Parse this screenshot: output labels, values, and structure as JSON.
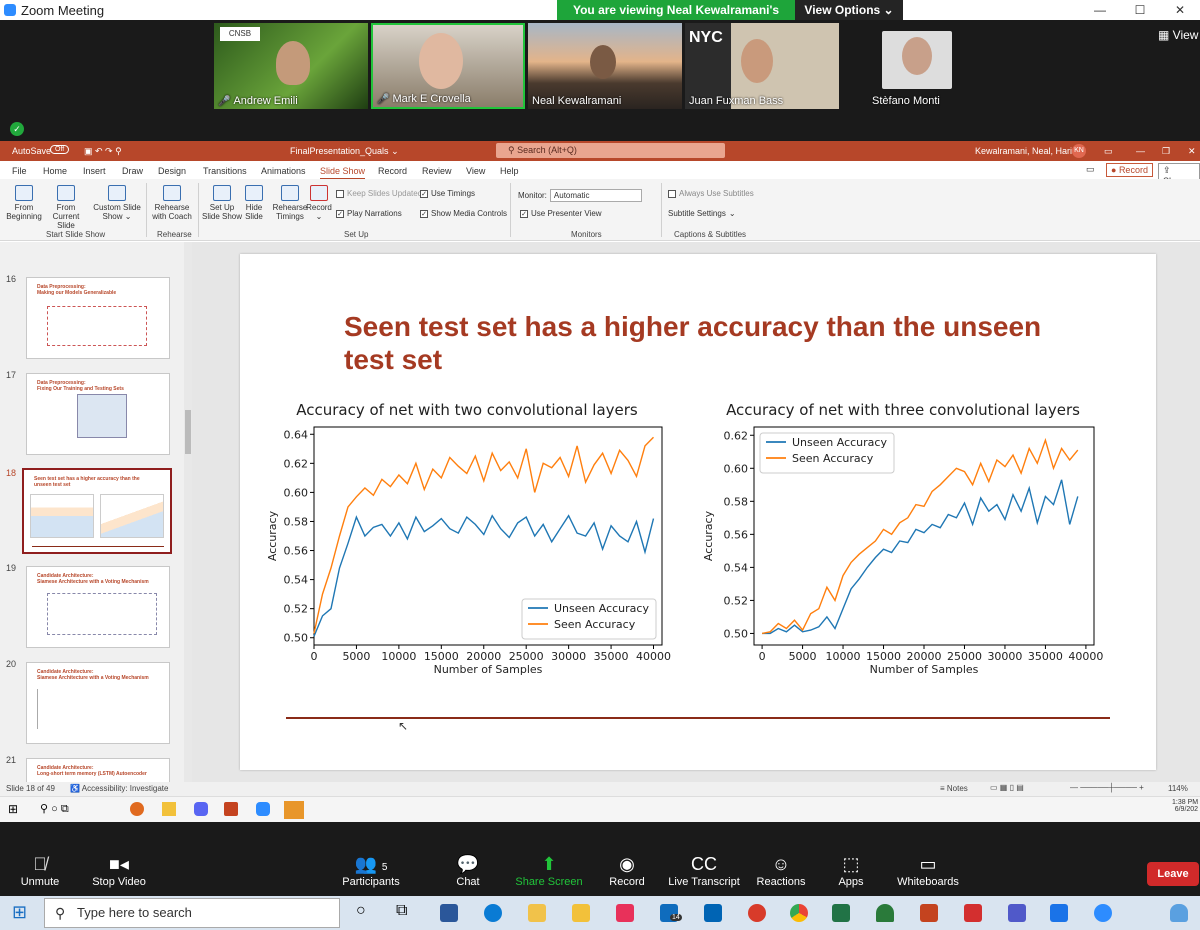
{
  "zoom": {
    "window_title": "Zoom Meeting",
    "banner_text": "You are viewing Neal Kewalramani's screen",
    "view_options": "View Options",
    "view_btn": "View",
    "participants": [
      {
        "name": "Andrew Emili",
        "muted": true,
        "color": "#3f6b2a"
      },
      {
        "name": "Mark E Crovella",
        "muted": true,
        "color": "#8a7d6a"
      },
      {
        "name": "Neal Kewalramani",
        "muted": false,
        "color": "#6a5a4a"
      },
      {
        "name": "Juan Fuxman Bass",
        "muted": false,
        "color": "#9a8a70"
      },
      {
        "name": "Stèfano Monti",
        "muted": false,
        "color": "#1a1a1a"
      }
    ],
    "controls": {
      "unmute": "Unmute",
      "stop_video": "Stop Video",
      "participants": "Participants",
      "participants_count": "5",
      "chat": "Chat",
      "share_screen": "Share Screen",
      "record": "Record",
      "live_transcript": "Live Transcript",
      "reactions": "Reactions",
      "apps": "Apps",
      "whiteboards": "Whiteboards",
      "leave": "Leave"
    }
  },
  "ppt": {
    "autosave": "AutoSave",
    "autosave_state": "Off",
    "filename": "FinalPresentation_Quals",
    "search_placeholder": "Search (Alt+Q)",
    "user": "Kewalramani, Neal, Harish",
    "user_initials": "KN",
    "menu": [
      "File",
      "Home",
      "Insert",
      "Draw",
      "Design",
      "Transitions",
      "Animations",
      "Slide Show",
      "Record",
      "Review",
      "View",
      "Help"
    ],
    "active_menu": "Slide Show",
    "record_btn": "Record",
    "share_btn": "Share",
    "ribbon": {
      "from_beginning": "From Beginning",
      "from_current": "From Current Slide",
      "custom_show": "Custom Slide Show",
      "group_start": "Start Slide Show",
      "rehearse_coach": "Rehearse with Coach",
      "group_rehearse": "Rehearse",
      "setup_show": "Set Up Slide Show",
      "hide_slide": "Hide Slide",
      "rehearse_timings": "Rehearse Timings",
      "record": "Record",
      "keep_updated": "Keep Slides Updated",
      "play_narrations": "Play Narrations",
      "use_timings": "Use Timings",
      "show_media": "Show Media Controls",
      "group_setup": "Set Up",
      "monitor_label": "Monitor:",
      "monitor_value": "Automatic",
      "presenter_view": "Use Presenter View",
      "group_monitors": "Monitors",
      "always_subtitles": "Always Use Subtitles",
      "subtitle_settings": "Subtitle Settings",
      "group_captions": "Captions & Subtitles"
    },
    "thumbnails": [
      {
        "num": "16",
        "title": "Data Preprocessing:\nMaking our Models Generalizable"
      },
      {
        "num": "17",
        "title": "Data Preprocessing:\nFixing Our Training and Testing Sets"
      },
      {
        "num": "18",
        "title": "Seen test set has a higher accuracy than the\nunseen test set"
      },
      {
        "num": "19",
        "title": "Candidate Architecture:\nSiamese Architecture with a Voting Mechanism"
      },
      {
        "num": "20",
        "title": "Candidate Architecture:\nSiamese Architecture with a Voting Mechanism"
      },
      {
        "num": "21",
        "title": "Candidate Architecture:\nLong-short term memory (LSTM) Autoencoder"
      }
    ],
    "slide_title": "Seen test set has a higher accuracy than the unseen test set",
    "status": {
      "slide_of": "Slide 18 of 49",
      "accessibility": "Accessibility: Investigate",
      "notes": "Notes",
      "zoom": "114%"
    },
    "clock_time": "1:38 PM",
    "clock_date": "6/9/202"
  },
  "chart_data": [
    {
      "type": "line",
      "title": "Accuracy of net with two convolutional layers",
      "xlabel": "Number of Samples",
      "ylabel": "Accuracy",
      "xlim": [
        0,
        41000
      ],
      "ylim": [
        0.495,
        0.645
      ],
      "xticks": [
        0,
        5000,
        10000,
        15000,
        20000,
        25000,
        30000,
        35000,
        40000
      ],
      "yticks": [
        0.5,
        0.52,
        0.54,
        0.56,
        0.58,
        0.6,
        0.62,
        0.64
      ],
      "legend": "bottom-right",
      "series": [
        {
          "name": "Unseen Accuracy",
          "color": "#1f77b4",
          "x": [
            0,
            1000,
            2000,
            3000,
            4000,
            5000,
            6000,
            7000,
            8000,
            9000,
            10000,
            11000,
            12000,
            13000,
            14000,
            15000,
            16000,
            17000,
            18000,
            19000,
            20000,
            21000,
            22000,
            23000,
            24000,
            25000,
            26000,
            27000,
            28000,
            29000,
            30000,
            31000,
            32000,
            33000,
            34000,
            35000,
            36000,
            37000,
            38000,
            39000,
            40000
          ],
          "values": [
            0.501,
            0.515,
            0.52,
            0.548,
            0.565,
            0.583,
            0.57,
            0.576,
            0.578,
            0.57,
            0.579,
            0.568,
            0.583,
            0.573,
            0.577,
            0.582,
            0.575,
            0.572,
            0.583,
            0.578,
            0.571,
            0.584,
            0.575,
            0.569,
            0.579,
            0.583,
            0.57,
            0.578,
            0.566,
            0.575,
            0.584,
            0.572,
            0.57,
            0.579,
            0.561,
            0.577,
            0.57,
            0.566,
            0.58,
            0.559,
            0.582
          ]
        },
        {
          "name": "Seen Accuracy",
          "color": "#ff7f0e",
          "x": [
            0,
            1000,
            2000,
            3000,
            4000,
            5000,
            6000,
            7000,
            8000,
            9000,
            10000,
            11000,
            12000,
            13000,
            14000,
            15000,
            16000,
            17000,
            18000,
            19000,
            20000,
            21000,
            22000,
            23000,
            24000,
            25000,
            26000,
            27000,
            28000,
            29000,
            30000,
            31000,
            32000,
            33000,
            34000,
            35000,
            36000,
            37000,
            38000,
            39000,
            40000
          ],
          "values": [
            0.503,
            0.53,
            0.548,
            0.57,
            0.59,
            0.597,
            0.603,
            0.598,
            0.609,
            0.604,
            0.612,
            0.606,
            0.62,
            0.602,
            0.616,
            0.61,
            0.624,
            0.618,
            0.613,
            0.625,
            0.608,
            0.627,
            0.615,
            0.621,
            0.61,
            0.63,
            0.6,
            0.62,
            0.617,
            0.624,
            0.611,
            0.632,
            0.607,
            0.619,
            0.627,
            0.613,
            0.629,
            0.622,
            0.611,
            0.632,
            0.638
          ]
        }
      ]
    },
    {
      "type": "line",
      "title": "Accuracy of net with three convolutional layers",
      "xlabel": "Number of Samples",
      "ylabel": "Accuracy",
      "xlim": [
        -1000,
        41000
      ],
      "ylim": [
        0.493,
        0.625
      ],
      "xticks": [
        0,
        5000,
        10000,
        15000,
        20000,
        25000,
        30000,
        35000,
        40000
      ],
      "yticks": [
        0.5,
        0.52,
        0.54,
        0.56,
        0.58,
        0.6,
        0.62
      ],
      "legend": "top-left",
      "series": [
        {
          "name": "Unseen Accuracy",
          "color": "#1f77b4",
          "x": [
            0,
            1000,
            2000,
            3000,
            4000,
            5000,
            6000,
            7000,
            8000,
            9000,
            10000,
            11000,
            12000,
            13000,
            14000,
            15000,
            16000,
            17000,
            18000,
            19000,
            20000,
            21000,
            22000,
            23000,
            24000,
            25000,
            26000,
            27000,
            28000,
            29000,
            30000,
            31000,
            32000,
            33000,
            34000,
            35000,
            36000,
            37000,
            38000,
            39000
          ],
          "values": [
            0.5,
            0.5,
            0.503,
            0.501,
            0.505,
            0.501,
            0.502,
            0.504,
            0.51,
            0.503,
            0.515,
            0.527,
            0.533,
            0.54,
            0.546,
            0.551,
            0.549,
            0.556,
            0.555,
            0.563,
            0.561,
            0.566,
            0.564,
            0.572,
            0.57,
            0.579,
            0.566,
            0.582,
            0.574,
            0.578,
            0.569,
            0.584,
            0.574,
            0.588,
            0.567,
            0.583,
            0.578,
            0.593,
            0.566,
            0.583
          ]
        },
        {
          "name": "Seen Accuracy",
          "color": "#ff7f0e",
          "x": [
            0,
            1000,
            2000,
            3000,
            4000,
            5000,
            6000,
            7000,
            8000,
            9000,
            10000,
            11000,
            12000,
            13000,
            14000,
            15000,
            16000,
            17000,
            18000,
            19000,
            20000,
            21000,
            22000,
            23000,
            24000,
            25000,
            26000,
            27000,
            28000,
            29000,
            30000,
            31000,
            32000,
            33000,
            34000,
            35000,
            36000,
            37000,
            38000,
            39000
          ],
          "values": [
            0.5,
            0.501,
            0.506,
            0.503,
            0.508,
            0.502,
            0.512,
            0.515,
            0.528,
            0.52,
            0.535,
            0.543,
            0.548,
            0.552,
            0.556,
            0.563,
            0.56,
            0.567,
            0.57,
            0.578,
            0.577,
            0.586,
            0.59,
            0.595,
            0.6,
            0.598,
            0.59,
            0.603,
            0.592,
            0.605,
            0.601,
            0.608,
            0.597,
            0.612,
            0.603,
            0.617,
            0.6,
            0.612,
            0.605,
            0.611
          ]
        }
      ]
    }
  ],
  "taskbar": {
    "search_placeholder": "Type here to search",
    "mail_badge": "14"
  }
}
